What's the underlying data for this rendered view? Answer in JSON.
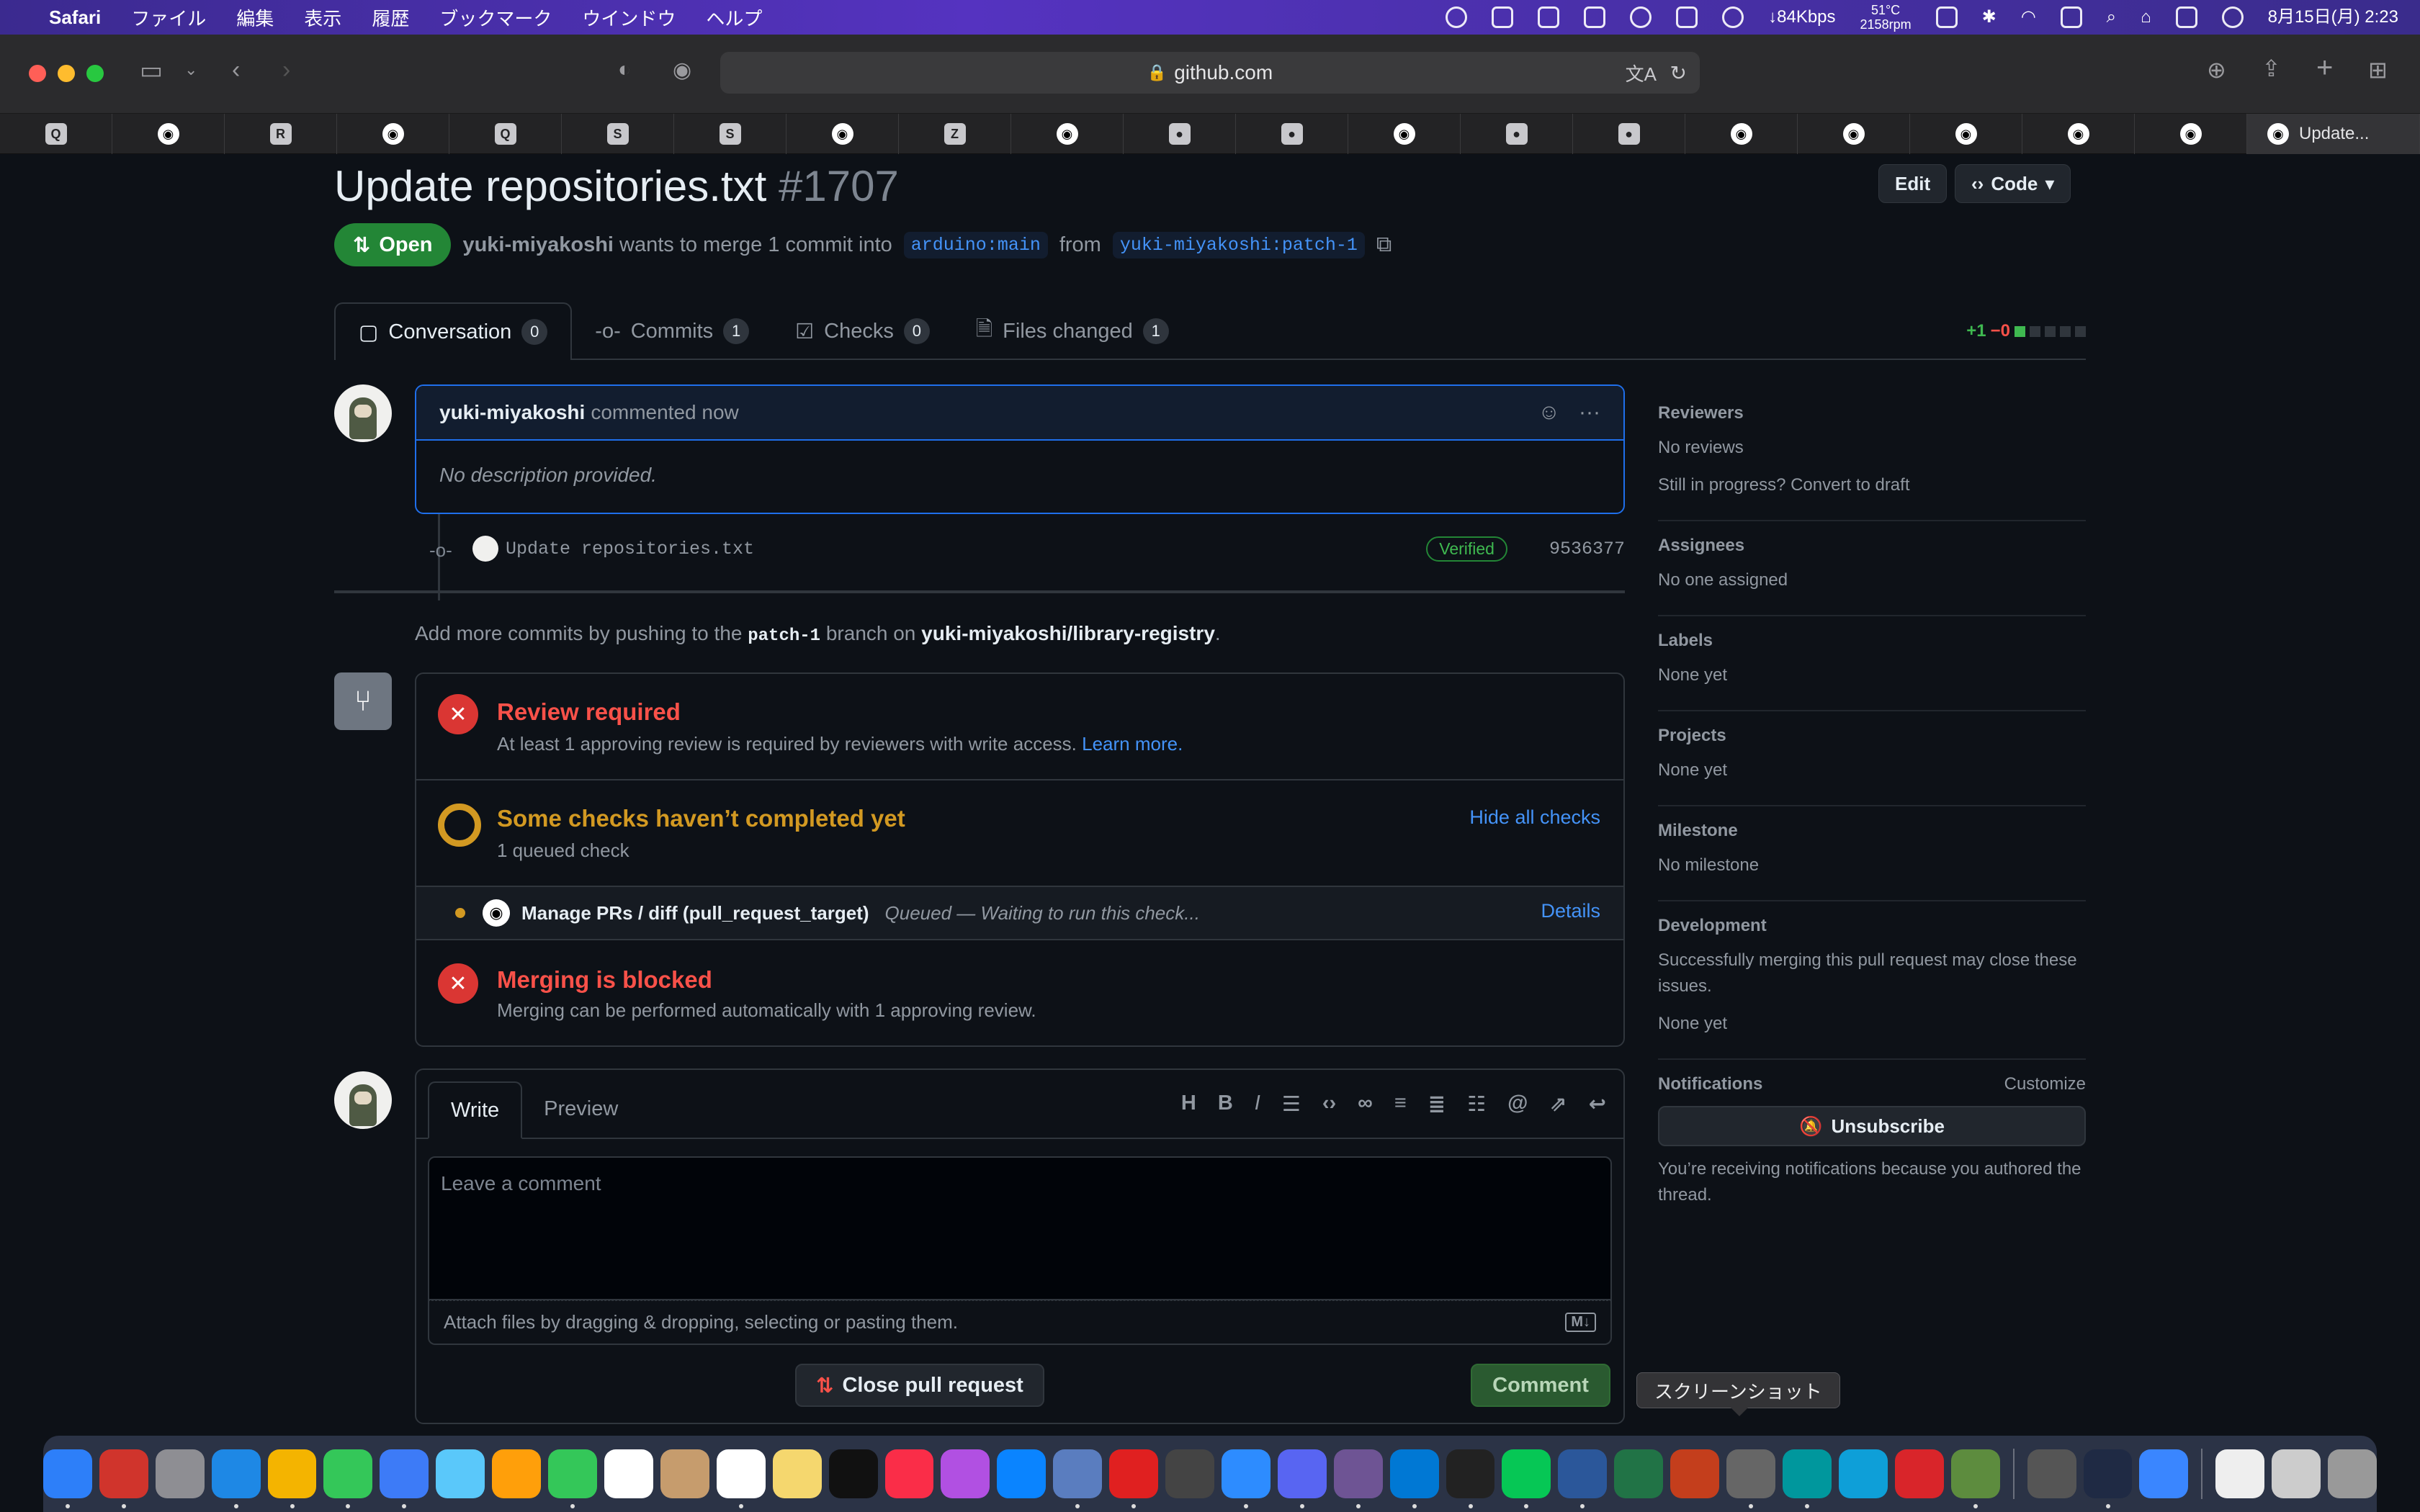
{
  "menubar": {
    "app": "Safari",
    "items": [
      "ファイル",
      "編集",
      "表示",
      "履歴",
      "ブックマーク",
      "ウインドウ",
      "ヘルプ"
    ],
    "network": "↓84Kbps",
    "temp_line1": "51°C",
    "temp_line2": "2158rpm",
    "datetime": "8月15日(月) 2:23"
  },
  "browser": {
    "url": "github.com",
    "active_tab_label": "Update...",
    "tab_favicons": [
      "Q",
      "gh",
      "R",
      "gh",
      "Q",
      "S",
      "S",
      "gh",
      "Z",
      "gh",
      "c",
      "c",
      "gh",
      "d",
      "g",
      "gh",
      "gh",
      "gh",
      "gh",
      "gh"
    ]
  },
  "pr": {
    "title": "Update repositories.txt",
    "number": "#1707",
    "edit_label": "Edit",
    "code_label": "Code",
    "state": "Open",
    "author": "yuki-miyakoshi",
    "merge_text": "wants to merge 1 commit into",
    "base_branch": "arduino:main",
    "from_text": "from",
    "head_branch": "yuki-miyakoshi:patch-1"
  },
  "tabs": [
    {
      "label": "Conversation",
      "count": "0"
    },
    {
      "label": "Commits",
      "count": "1"
    },
    {
      "label": "Checks",
      "count": "0"
    },
    {
      "label": "Files changed",
      "count": "1"
    }
  ],
  "diffstat": {
    "additions": "+1",
    "deletions": "−0"
  },
  "comment": {
    "author": "yuki-miyakoshi",
    "time": "commented now",
    "body": "No description provided."
  },
  "commit": {
    "message": "Update repositories.txt",
    "badge": "Verified",
    "sha": "9536377"
  },
  "hint": {
    "prefix": "Add more commits by pushing to the",
    "branch": "patch-1",
    "middle": "branch on",
    "repo": "yuki-miyakoshi/library-registry",
    "suffix": "."
  },
  "merge": {
    "review_title": "Review required",
    "review_sub": "At least 1 approving review is required by reviewers with write access.",
    "learn_more": "Learn more.",
    "checks_title": "Some checks haven’t completed yet",
    "checks_sub": "1 queued check",
    "hide_checks": "Hide all checks",
    "check_name": "Manage PRs / diff (pull_request_target)",
    "check_status": "Queued — Waiting to run this check...",
    "details": "Details",
    "blocked_title": "Merging is blocked",
    "blocked_sub": "Merging can be performed automatically with 1 approving review."
  },
  "editor": {
    "write_tab": "Write",
    "preview_tab": "Preview",
    "placeholder": "Leave a comment",
    "attach": "Attach files by dragging & dropping, selecting or pasting them.",
    "close_pr": "Close pull request",
    "comment_btn": "Comment"
  },
  "sidebar": {
    "reviewers_h": "Reviewers",
    "reviewers_t1": "No reviews",
    "reviewers_t2": "Still in progress? Convert to draft",
    "assignees_h": "Assignees",
    "assignees_t": "No one assigned",
    "labels_h": "Labels",
    "labels_t": "None yet",
    "projects_h": "Projects",
    "projects_t": "None yet",
    "milestone_h": "Milestone",
    "milestone_t": "No milestone",
    "dev_h": "Development",
    "dev_t": "Successfully merging this pull request may close these issues.",
    "dev_t2": "None yet",
    "notif_h": "Notifications",
    "customize": "Customize",
    "unsubscribe": "Unsubscribe",
    "notif_t": "You’re receiving notifications because you authored the thread."
  },
  "tooltip": "スクリーンショット",
  "colors": {
    "bg": "#0d1117",
    "open_green": "#238636",
    "link_blue": "#4493f8",
    "error_red": "#f85149",
    "pending_yellow": "#d29922"
  }
}
